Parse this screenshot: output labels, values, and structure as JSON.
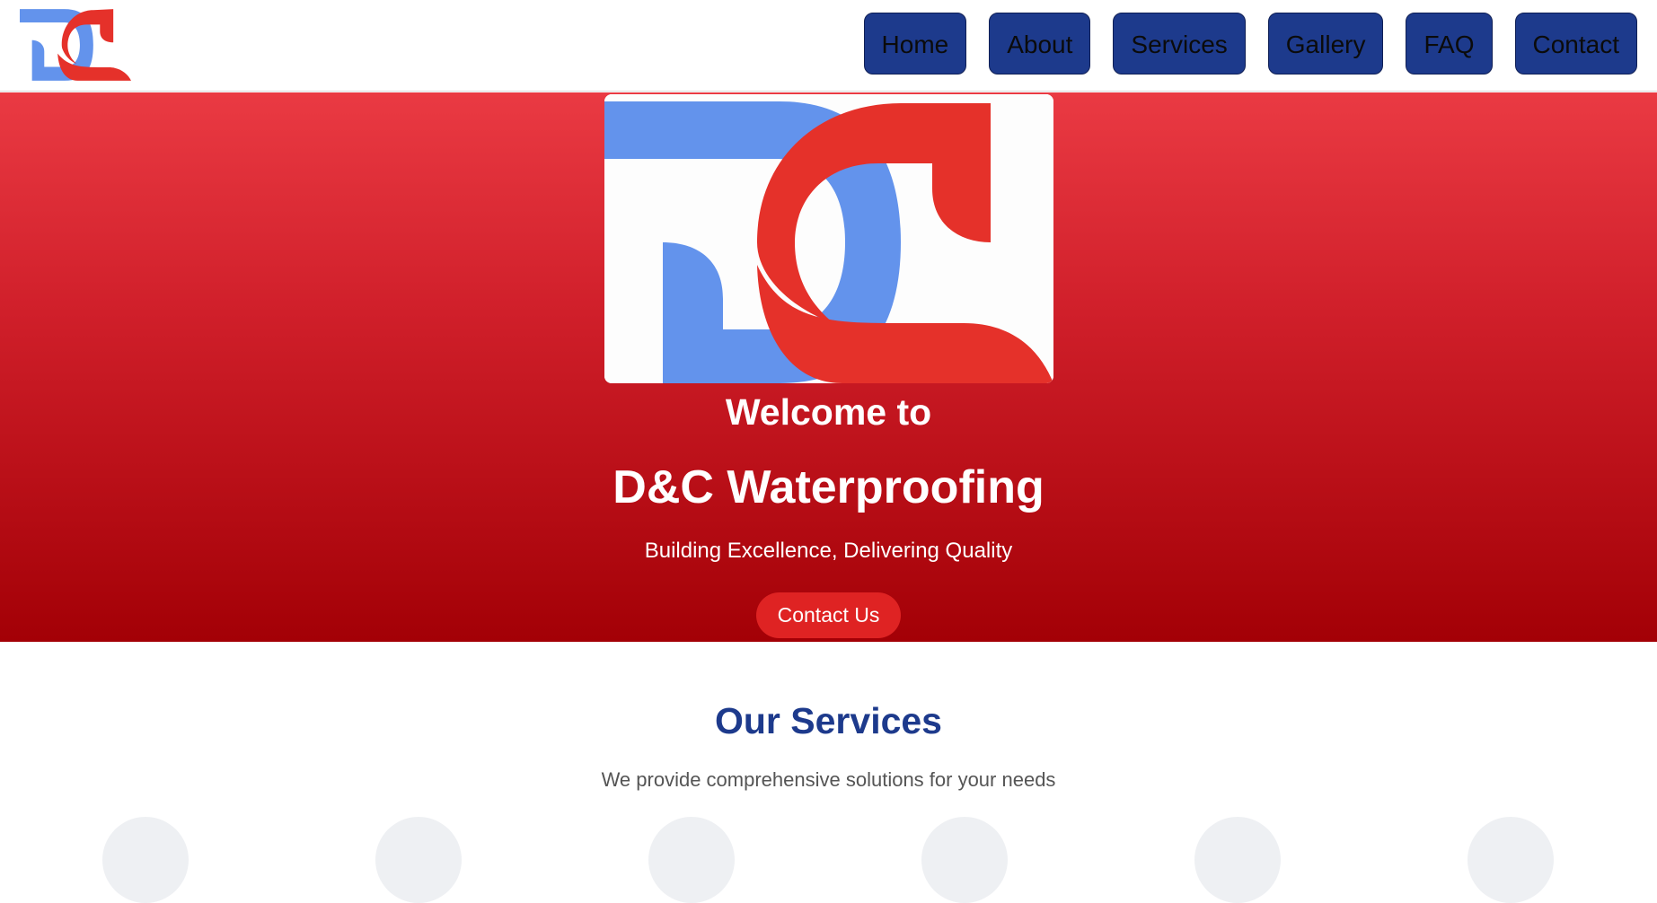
{
  "header": {
    "logo_icon": "dc-logo",
    "nav": [
      {
        "id": "home",
        "label": "Home"
      },
      {
        "id": "about",
        "label": "About"
      },
      {
        "id": "services",
        "label": "Services"
      },
      {
        "id": "gallery",
        "label": "Gallery"
      },
      {
        "id": "faq",
        "label": "FAQ"
      },
      {
        "id": "contact",
        "label": "Contact"
      }
    ]
  },
  "hero": {
    "logo_icon": "dc-logo",
    "welcome": "Welcome to",
    "company": "D&C Waterproofing",
    "tagline": "Building Excellence, Delivering Quality",
    "cta_label": "Contact Us"
  },
  "services": {
    "title": "Our Services",
    "subtitle": "We provide comprehensive solutions for your needs",
    "icon_count_visible": 6
  },
  "colors": {
    "nav_bg": "#1d3a8c",
    "hero_top": "#ea3a43",
    "hero_bottom": "#a30006",
    "cta_bg": "#df2323",
    "logo_blue": "#6393ec",
    "logo_red": "#e5312a",
    "title_blue": "#1d3a8c"
  }
}
